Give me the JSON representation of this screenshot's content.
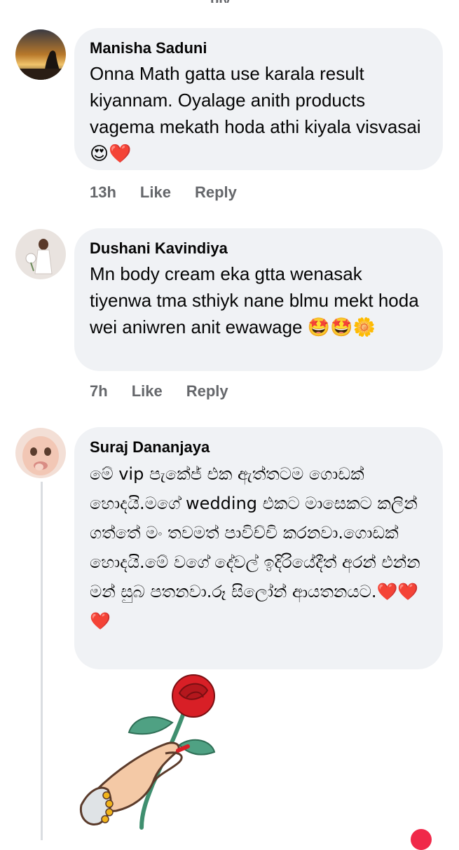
{
  "comments": [
    {
      "author": "Manisha Saduni",
      "text": "Onna Math gatta use karala result kiyannam. Oyalage anith products vagema mekath hoda athi kiyala visvasai 😍❤️",
      "time": "13h",
      "like_label": "Like",
      "reply_label": "Reply"
    },
    {
      "author": "Dushani Kavindiya",
      "text": "Mn body cream eka gtta wenasak tiyenwa tma sthiyk nane blmu mekt hoda wei aniwren anit ewawage 🤩🤩🌼",
      "time": "7h",
      "like_label": "Like",
      "reply_label": "Reply"
    },
    {
      "author": "Suraj Dananjaya",
      "text": "මේ vip පැකේජ් එක ඇත්තටම ගොඩක් හොදයි.මගේ wedding එකට මාසෙකට කලින් ගත්තේ මං තවමත් පාවිච්චි කරනවා.ගොඩක් හොදයි.මේ වගේ දේවල් ඉදිරියේදීත් අරන් එන්න මන් සුබ පතනවා.රූ සිලෝන් ආයතනයට.❤️❤️❤️"
    }
  ],
  "colors": {
    "bubble": "#f0f2f5",
    "meta_text": "#65676b",
    "rose": "#d81f26",
    "stem": "#3f8f6f"
  },
  "icons": {
    "sticker": "rose-in-hand-sticker"
  }
}
